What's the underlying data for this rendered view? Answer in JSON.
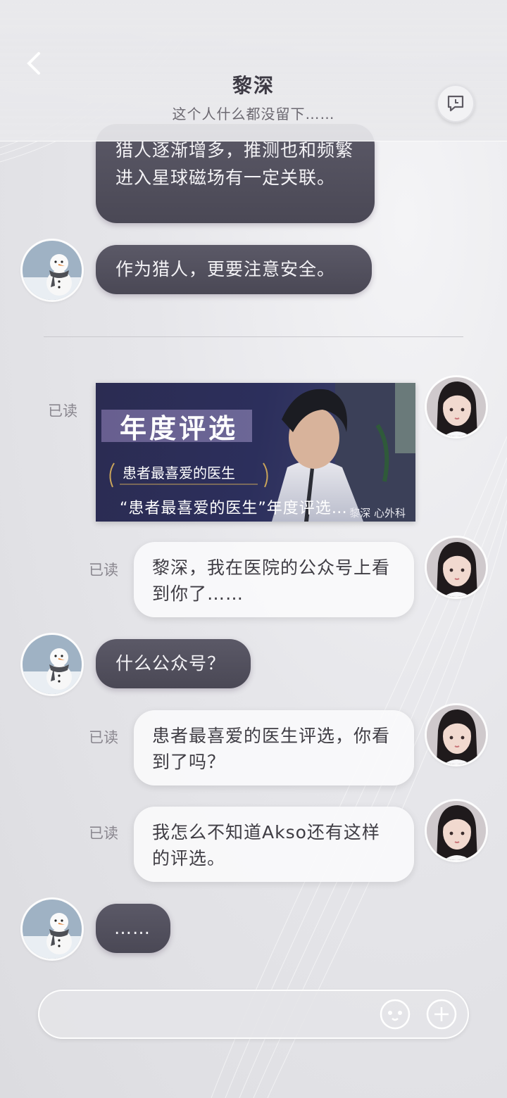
{
  "header": {
    "title": "黎深",
    "subtitle": "这个人什么都没留下……"
  },
  "messages": [
    {
      "side": "in",
      "text": "猎人逐渐增多，推测也和频繁进入星球磁场有一定关联。"
    },
    {
      "side": "in",
      "text": "作为猎人，更要注意安全。"
    },
    {
      "side": "out",
      "type": "image",
      "read": "已读",
      "card": {
        "title": "年度评选",
        "award": "患者最喜爱的医生",
        "caption": "“患者最喜爱的医生”年度评选…",
        "author": "黎深 心外科"
      }
    },
    {
      "side": "out",
      "read": "已读",
      "text": "黎深，我在医院的公众号上看到你了……"
    },
    {
      "side": "in",
      "text": "什么公众号？"
    },
    {
      "side": "out",
      "read": "已读",
      "text": "患者最喜爱的医生评选，你看到了吗？"
    },
    {
      "side": "out",
      "read": "已读",
      "text": "我怎么不知道Akso还有这样的评选。"
    },
    {
      "side": "in",
      "text": "……"
    }
  ],
  "input": {
    "placeholder": "",
    "emoji_icon": "smiley-icon",
    "add_icon": "plus-icon"
  },
  "colors": {
    "incoming_bubble": "#4f4d5a",
    "outgoing_bubble": "#fafafb",
    "background": "#e6e6ea"
  }
}
